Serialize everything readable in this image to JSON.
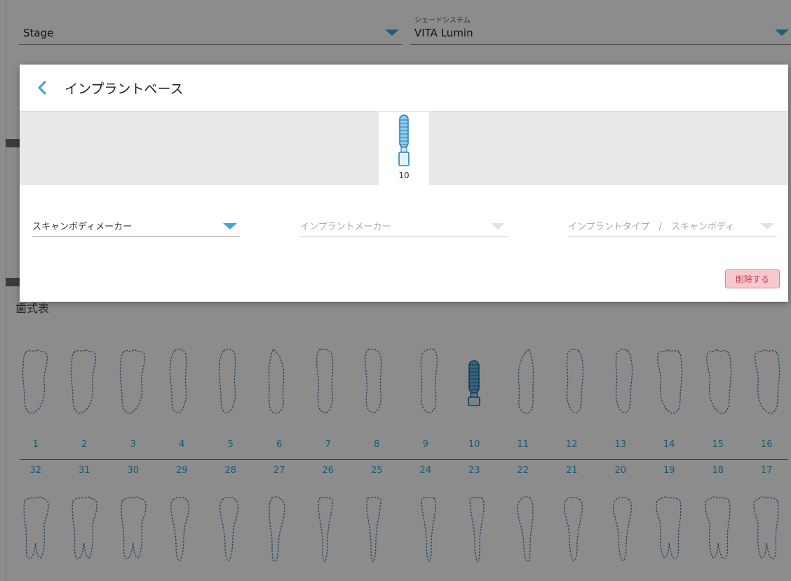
{
  "top_fields": {
    "stage": {
      "value": "Stage"
    },
    "shade_system": {
      "label": "シェードシステム",
      "value": "VITA Lumin"
    }
  },
  "tooth_chart": {
    "title": "歯式表",
    "upper_numbers": [
      "1",
      "2",
      "3",
      "4",
      "5",
      "6",
      "7",
      "8",
      "9",
      "10",
      "11",
      "12",
      "13",
      "14",
      "15",
      "16"
    ],
    "lower_numbers": [
      "32",
      "31",
      "30",
      "29",
      "28",
      "27",
      "26",
      "25",
      "24",
      "23",
      "22",
      "21",
      "20",
      "19",
      "18",
      "17"
    ],
    "implant_tooth": "10"
  },
  "modal": {
    "title": "インプラントベース",
    "selected_tooth": "10",
    "scan_body_maker": {
      "value": "スキャンボディメーカー"
    },
    "implant_maker": {
      "placeholder": "インプラントメーカー"
    },
    "implant_type": {
      "placeholder": "インプラントタイプ　/　スキャンボディ"
    },
    "delete_label": "削除する"
  },
  "colors": {
    "accent": "#45a6d9",
    "delete_bg": "#f7c9ce",
    "delete_text": "#c5404f"
  }
}
